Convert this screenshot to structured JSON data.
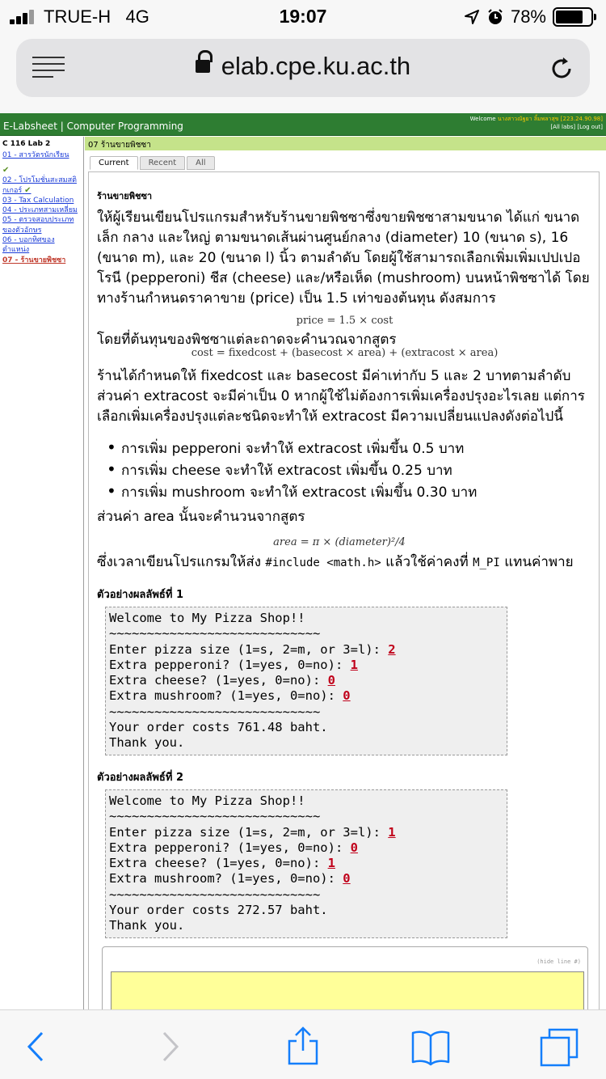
{
  "status": {
    "carrier": "TRUE-H",
    "network": "4G",
    "time": "19:07",
    "battery": "78%",
    "battery_level": 0.78
  },
  "browser": {
    "url": "elab.cpe.ku.ac.th"
  },
  "site": {
    "title": "E-Labsheet | Computer Programming",
    "welcome_prefix": "Welcome",
    "user_name": "นางสาวณัฐยา ลิ้มพลาสุข",
    "ip": "[223.24.90.98]",
    "links": "[All labs] [Log out]"
  },
  "sidebar": {
    "heading": "C 116 Lab 2",
    "items": [
      {
        "label": "01 - สารวัตรนักเรียน",
        "done": true
      },
      {
        "label": "02 - โปรโมชั่นสะสมสติกเกอร์",
        "done": true
      },
      {
        "label": "03 - Tax Calculation",
        "done": false
      },
      {
        "label": "04 - ประเภทสามเหลี่ยม",
        "done": false
      },
      {
        "label": "05 - ตรวจสอบประเภทของตัวอักษร",
        "done": false
      },
      {
        "label": "06 - บอกทิศของตำแหน่ง",
        "done": false
      },
      {
        "label": "07 - ร้านขายพิชซา",
        "done": false
      }
    ]
  },
  "content": {
    "title": "07 ร้านขายพิชซา",
    "tabs": [
      "Current",
      "Recent",
      "All"
    ],
    "heading": "ร้านขายพิชซา",
    "intro": "ให้ผู้เรียนเขียนโปรแกรมสำหรับร้านขายพิชซาซึ่งขายพิชซาสามขนาด ได้แก่ ขนาดเล็ก กลาง และใหญ่ ตามขนาดเส้นผ่านศูนย์กลาง (diameter) 10 (ขนาด s), 16 (ขนาด m), และ 20 (ขนาด l) นิ้ว ตามลำดับ โดยผู้ใช้สามารถเลือกเพิ่มเพิ่มเปปเปอโรนี (pepperoni) ชีส (cheese) และ/หรือเห็ด (mushroom) บนหน้าพิชซาได้ โดยทางร้านกำหนดราคาขาย (price) เป็น 1.5 เท่าของต้นทุน ดังสมการ",
    "formula_price": "price = 1.5 × cost",
    "cost_intro": "โดยที่ต้นทุนของพิชซาแต่ละถาดจะคำนวณจากสูตร",
    "formula_cost": "cost = fixedcost + (basecost × area) + (extracost × area)",
    "para2": "ร้านได้กำหนดให้ fixedcost และ basecost มีค่าเท่ากับ 5 และ 2 บาทตามลำดับ ส่วนค่า extracost จะมีค่าเป็น 0 หากผู้ใช้ไม่ต้องการเพิ่มเครื่องปรุงอะไรเลย แต่การเลือกเพิ่มเครื่องปรุงแต่ละชนิดจะทำให้ extracost มีความเปลี่ยนแปลงดังต่อไปนี้",
    "bullets": [
      "การเพิ่ม pepperoni จะทำให้ extracost เพิ่มขึ้น 0.5 บาท",
      "การเพิ่ม cheese จะทำให้ extracost เพิ่มขึ้น 0.25 บาท",
      "การเพิ่ม mushroom จะทำให้ extracost เพิ่มขึ้น 0.30 บาท"
    ],
    "area_intro": "ส่วนค่า area นั้นจะคำนวนจากสูตร",
    "formula_area": "area = π × (diameter)²/4",
    "include_pre": "ซึ่งเวลาเขียนโปรแกรมให้ส่ง",
    "include_code": "#include <math.h>",
    "include_mid": "แล้วใช้ค่าคงที่",
    "mpi": "M_PI",
    "include_post": "แทนค่าพาย",
    "example1_label": "ตัวอย่างผลลัพธ์ที่ 1",
    "example2_label": "ตัวอย่างผลลัพธ์ที่ 2",
    "hide_line": "(hide line #)"
  },
  "examples": [
    {
      "welcome": "Welcome to My Pizza Shop!!",
      "rule": "~~~~~~~~~~~~~~~~~~~~~~~~~~~~",
      "size_prompt": "Enter pizza size (1=s, 2=m, or 3=l): ",
      "size": "2",
      "pep_prompt": "Extra pepperoni? (1=yes, 0=no): ",
      "pep": "1",
      "cheese_prompt": "Extra cheese? (1=yes, 0=no): ",
      "cheese": "0",
      "mush_prompt": "Extra mushroom? (1=yes, 0=no): ",
      "mush": "0",
      "result": "Your order costs 761.48 baht.",
      "thanks": "Thank you."
    },
    {
      "welcome": "Welcome to My Pizza Shop!!",
      "rule": "~~~~~~~~~~~~~~~~~~~~~~~~~~~~",
      "size_prompt": "Enter pizza size (1=s, 2=m, or 3=l): ",
      "size": "1",
      "pep_prompt": "Extra pepperoni? (1=yes, 0=no): ",
      "pep": "0",
      "cheese_prompt": "Extra cheese? (1=yes, 0=no): ",
      "cheese": "1",
      "mush_prompt": "Extra mushroom? (1=yes, 0=no): ",
      "mush": "0",
      "result": "Your order costs 272.57 baht.",
      "thanks": "Thank you."
    }
  ],
  "icons": {
    "signal": "signal-bars-icon",
    "location": "location-arrow-icon",
    "alarm": "alarm-clock-icon",
    "lock": "lock-icon",
    "reload": "reload-icon",
    "menu": "reader-menu-icon",
    "back": "back-chevron-icon",
    "forward": "forward-chevron-icon",
    "share": "share-icon",
    "bookmarks": "book-icon",
    "tabs": "tabs-icon"
  }
}
